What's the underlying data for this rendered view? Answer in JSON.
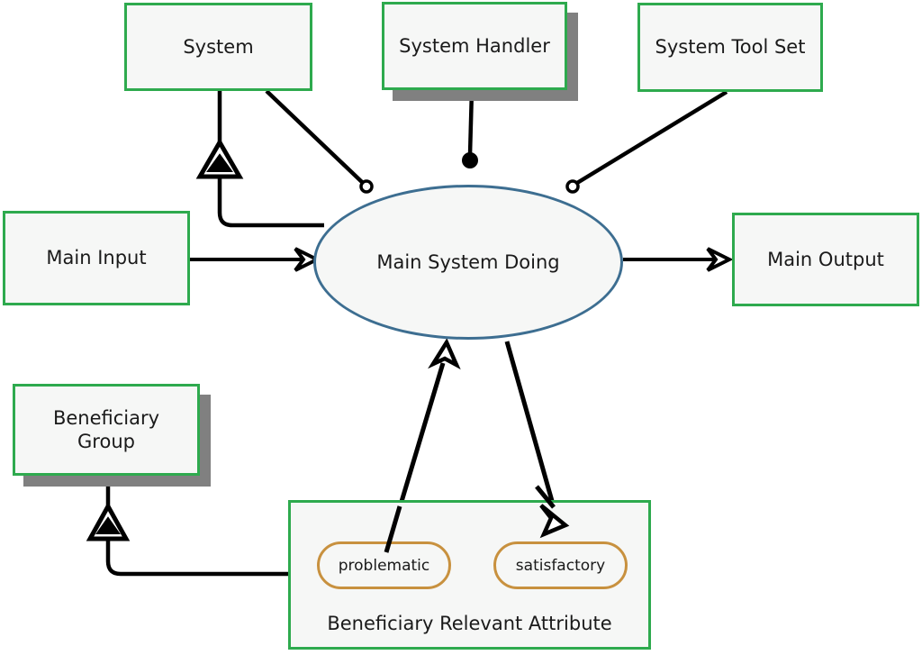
{
  "diagram": {
    "title": "Main System Doing context diagram",
    "colors": {
      "box_border_green": "#2eaa4e",
      "box_fill": "#f6f7f6",
      "ellipse_border_blue": "#3d6e91",
      "pill_border_orange": "#c8913f",
      "shadow_gray": "#808080",
      "edge_black": "#000000",
      "background": "#ffffff"
    },
    "nodes": {
      "system": {
        "label": "System",
        "shape": "rectangle",
        "stacked": false
      },
      "system_handler": {
        "label": "System Handler",
        "shape": "rectangle",
        "stacked": true
      },
      "system_tool_set": {
        "label": "System Tool Set",
        "shape": "rectangle",
        "stacked": false
      },
      "main_input": {
        "label": "Main Input",
        "shape": "rectangle",
        "stacked": false
      },
      "main_output": {
        "label": "Main Output",
        "shape": "rectangle",
        "stacked": false
      },
      "main_system_doing": {
        "label": "Main System Doing",
        "shape": "ellipse",
        "stacked": false
      },
      "beneficiary_group": {
        "label": "Beneficiary\nGroup",
        "label_line_1": "Beneficiary",
        "label_line_2": "Group",
        "shape": "rectangle",
        "stacked": true
      },
      "beneficiary_relevant_attribute": {
        "label": "Beneficiary Relevant Attribute",
        "shape": "rectangle-container",
        "values": [
          {
            "label": "problematic",
            "shape": "stadium"
          },
          {
            "label": "satisfactory",
            "shape": "stadium"
          }
        ]
      }
    },
    "edges": [
      {
        "from": "main_input",
        "to": "main_system_doing",
        "endpoint": "open-arrowhead"
      },
      {
        "from": "main_system_doing",
        "to": "main_output",
        "endpoint": "open-arrowhead"
      },
      {
        "from": "system",
        "to": "main_system_doing",
        "endpoint": "hollow-circle"
      },
      {
        "from": "system_handler",
        "to": "main_system_doing",
        "endpoint": "filled-circle"
      },
      {
        "from": "system_tool_set",
        "to": "main_system_doing",
        "endpoint": "hollow-circle"
      },
      {
        "from": "main_system_doing",
        "to": "system",
        "endpoint": "nested-triangle"
      },
      {
        "from": "beneficiary_relevant_attribute",
        "to": "beneficiary_group",
        "endpoint": "nested-triangle"
      },
      {
        "from": "problematic",
        "to": "main_system_doing",
        "endpoint": "open-arrowhead"
      },
      {
        "from": "main_system_doing",
        "to": "satisfactory",
        "endpoint": "open-arrowhead"
      }
    ]
  }
}
